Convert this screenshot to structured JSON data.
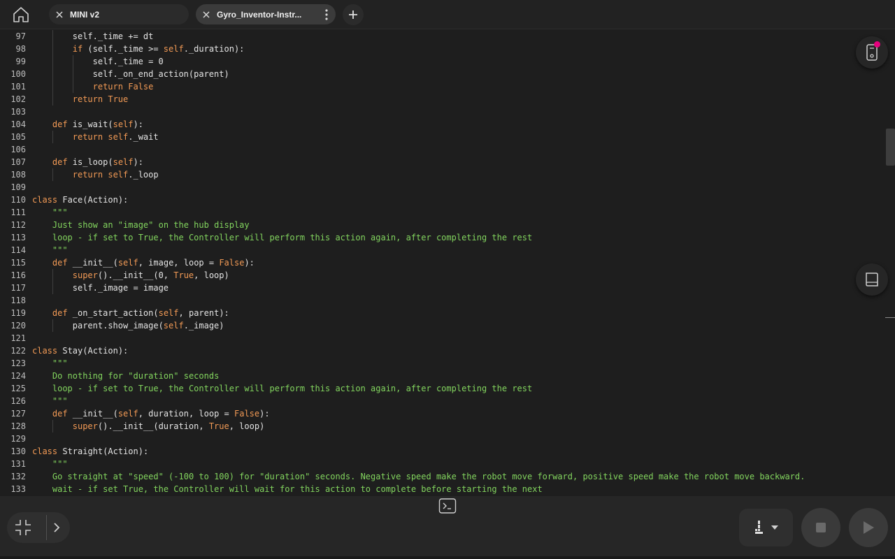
{
  "tabs": [
    {
      "label": "MINI v2",
      "active": false
    },
    {
      "label": "Gyro_Inventor-Instr...",
      "active": true
    }
  ],
  "editor": {
    "lines": [
      {
        "n": "97",
        "indent": 2,
        "tokens": [
          [
            "",
            "self._time += dt"
          ]
        ]
      },
      {
        "n": "98",
        "indent": 2,
        "tokens": [
          [
            "kw",
            "if"
          ],
          [
            "",
            " (self._time >= "
          ],
          [
            "kw",
            "self"
          ],
          [
            "",
            "._duration):"
          ]
        ]
      },
      {
        "n": "99",
        "indent": 3,
        "tokens": [
          [
            "",
            "self._time = 0"
          ]
        ]
      },
      {
        "n": "100",
        "indent": 3,
        "tokens": [
          [
            "",
            "self._on_end_action(parent)"
          ]
        ]
      },
      {
        "n": "101",
        "indent": 3,
        "tokens": [
          [
            "kw",
            "return"
          ],
          [
            "",
            " "
          ],
          [
            "kb",
            "False"
          ]
        ]
      },
      {
        "n": "102",
        "indent": 2,
        "tokens": [
          [
            "kw",
            "return"
          ],
          [
            "",
            " "
          ],
          [
            "kb",
            "True"
          ]
        ]
      },
      {
        "n": "103",
        "indent": 0,
        "tokens": []
      },
      {
        "n": "104",
        "indent": 1,
        "tokens": [
          [
            "kw",
            "def"
          ],
          [
            "",
            " is_wait("
          ],
          [
            "kw",
            "self"
          ],
          [
            "",
            "):"
          ]
        ]
      },
      {
        "n": "105",
        "indent": 2,
        "tokens": [
          [
            "kw",
            "return"
          ],
          [
            "",
            " "
          ],
          [
            "kw",
            "self"
          ],
          [
            "",
            "._wait"
          ]
        ]
      },
      {
        "n": "106",
        "indent": 0,
        "tokens": []
      },
      {
        "n": "107",
        "indent": 1,
        "tokens": [
          [
            "kw",
            "def"
          ],
          [
            "",
            " is_loop("
          ],
          [
            "kw",
            "self"
          ],
          [
            "",
            "):"
          ]
        ]
      },
      {
        "n": "108",
        "indent": 2,
        "tokens": [
          [
            "kw",
            "return"
          ],
          [
            "",
            " "
          ],
          [
            "kw",
            "self"
          ],
          [
            "",
            "._loop"
          ]
        ]
      },
      {
        "n": "109",
        "indent": 0,
        "tokens": []
      },
      {
        "n": "110",
        "indent": 0,
        "tokens": [
          [
            "kw",
            "class"
          ],
          [
            "",
            " Face(Action):"
          ]
        ]
      },
      {
        "n": "111",
        "indent": 1,
        "tokens": [
          [
            "str",
            "\"\"\""
          ]
        ]
      },
      {
        "n": "112",
        "indent": 1,
        "tokens": [
          [
            "str",
            "Just show an \"image\" on the hub display"
          ]
        ]
      },
      {
        "n": "113",
        "indent": 1,
        "tokens": [
          [
            "str",
            "loop - if set to True, the Controller will perform this action again, after completing the rest"
          ]
        ]
      },
      {
        "n": "114",
        "indent": 1,
        "tokens": [
          [
            "str",
            "\"\"\""
          ]
        ]
      },
      {
        "n": "115",
        "indent": 1,
        "tokens": [
          [
            "kw",
            "def"
          ],
          [
            "",
            " __init__("
          ],
          [
            "kw",
            "self"
          ],
          [
            "",
            ", image, loop = "
          ],
          [
            "kb",
            "False"
          ],
          [
            "",
            "):"
          ]
        ]
      },
      {
        "n": "116",
        "indent": 2,
        "tokens": [
          [
            "kw",
            "super"
          ],
          [
            "",
            "().__init__(0, "
          ],
          [
            "kb",
            "True"
          ],
          [
            "",
            ", loop)"
          ]
        ]
      },
      {
        "n": "117",
        "indent": 2,
        "tokens": [
          [
            "",
            "self._image = image"
          ]
        ]
      },
      {
        "n": "118",
        "indent": 0,
        "tokens": []
      },
      {
        "n": "119",
        "indent": 1,
        "tokens": [
          [
            "kw",
            "def"
          ],
          [
            "",
            " _on_start_action("
          ],
          [
            "kw",
            "self"
          ],
          [
            "",
            ", parent):"
          ]
        ]
      },
      {
        "n": "120",
        "indent": 2,
        "tokens": [
          [
            "",
            "parent.show_image("
          ],
          [
            "kw",
            "self"
          ],
          [
            "",
            "._image)"
          ]
        ]
      },
      {
        "n": "121",
        "indent": 0,
        "tokens": []
      },
      {
        "n": "122",
        "indent": 0,
        "tokens": [
          [
            "kw",
            "class"
          ],
          [
            "",
            " Stay(Action):"
          ]
        ]
      },
      {
        "n": "123",
        "indent": 1,
        "tokens": [
          [
            "str",
            "\"\"\""
          ]
        ]
      },
      {
        "n": "124",
        "indent": 1,
        "tokens": [
          [
            "str",
            "Do nothing for \"duration\" seconds"
          ]
        ]
      },
      {
        "n": "125",
        "indent": 1,
        "tokens": [
          [
            "str",
            "loop - if set to True, the Controller will perform this action again, after completing the rest"
          ]
        ]
      },
      {
        "n": "126",
        "indent": 1,
        "tokens": [
          [
            "str",
            "\"\"\""
          ]
        ]
      },
      {
        "n": "127",
        "indent": 1,
        "tokens": [
          [
            "kw",
            "def"
          ],
          [
            "",
            " __init__("
          ],
          [
            "kw",
            "self"
          ],
          [
            "",
            ", duration, loop = "
          ],
          [
            "kb",
            "False"
          ],
          [
            "",
            "):"
          ]
        ]
      },
      {
        "n": "128",
        "indent": 2,
        "tokens": [
          [
            "kw",
            "super"
          ],
          [
            "",
            "().__init__(duration, "
          ],
          [
            "kb",
            "True"
          ],
          [
            "",
            ", loop)"
          ]
        ]
      },
      {
        "n": "129",
        "indent": 0,
        "tokens": []
      },
      {
        "n": "130",
        "indent": 0,
        "tokens": [
          [
            "kw",
            "class"
          ],
          [
            "",
            " Straight(Action):"
          ]
        ]
      },
      {
        "n": "131",
        "indent": 1,
        "tokens": [
          [
            "str",
            "\"\"\""
          ]
        ]
      },
      {
        "n": "132",
        "indent": 1,
        "tokens": [
          [
            "str",
            "Go straight at \"speed\" (-100 to 100) for \"duration\" seconds. Negative speed make the robot move forward, positive speed make the robot move backward."
          ]
        ]
      },
      {
        "n": "133",
        "indent": 1,
        "tokens": [
          [
            "str",
            "wait - if set True, the Controller will wait for this action to complete before starting the next"
          ]
        ]
      }
    ]
  },
  "icons": {
    "home": "home-icon",
    "close": "close-icon",
    "more": "more-vertical-icon",
    "add": "plus-icon",
    "hub": "hub-device-icon",
    "help": "book-icon",
    "terminal": "terminal-icon",
    "collapse": "collapse-icon",
    "expand": "chevron-right-icon",
    "slot": "slot-icon",
    "stop": "stop-icon",
    "play": "play-icon"
  },
  "colors": {
    "keyword": "#f29a55",
    "string": "#82d45e",
    "text": "#e4e4e4",
    "hub_status": "#e6007e"
  }
}
